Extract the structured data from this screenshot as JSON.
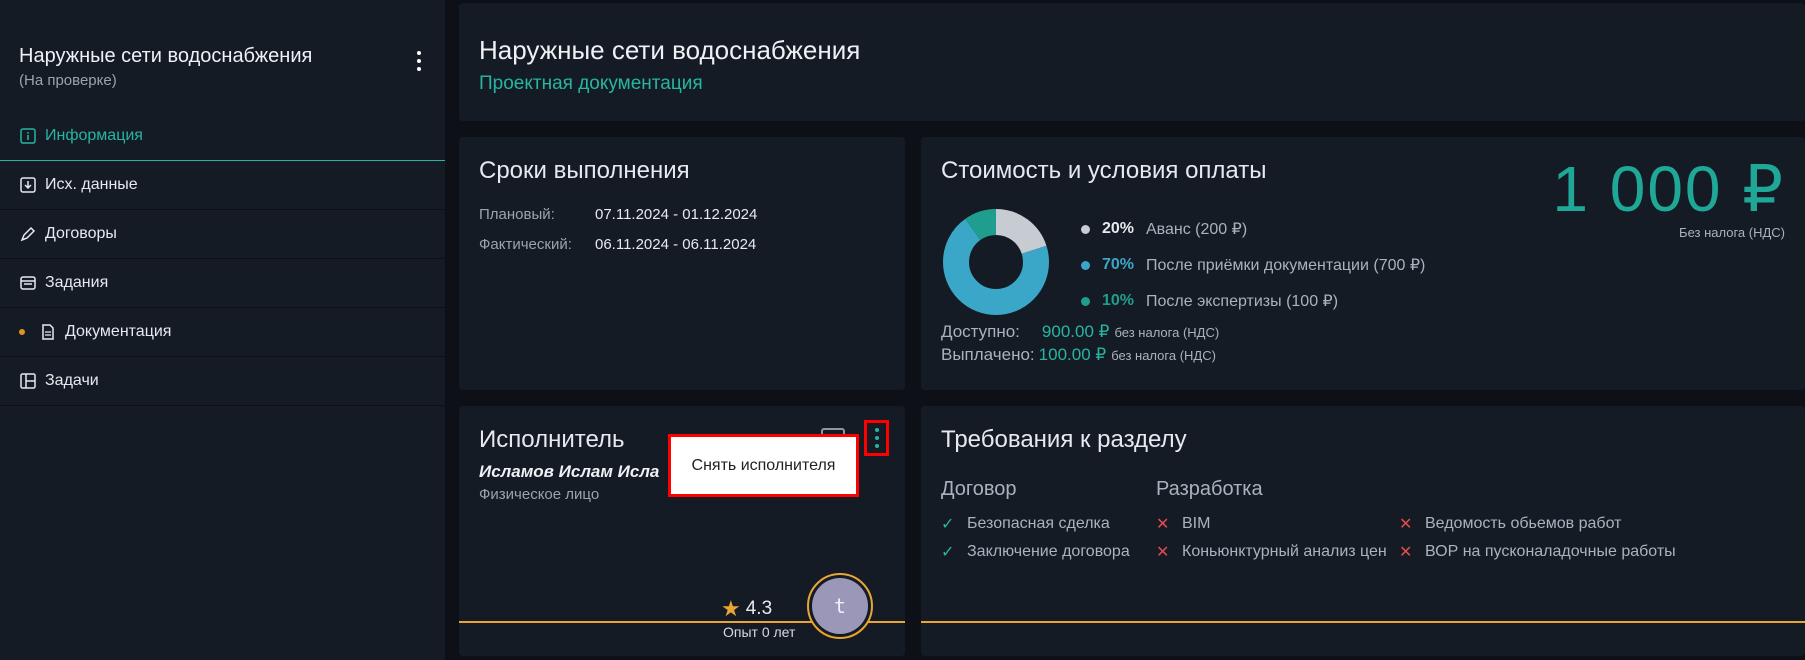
{
  "sidebar": {
    "title": "Наружные сети водоснабжения",
    "status": "(На проверке)",
    "items": [
      {
        "label": "Информация",
        "icon": "info-icon"
      },
      {
        "label": "Исх. данные",
        "icon": "download-icon"
      },
      {
        "label": "Договоры",
        "icon": "pen-icon"
      },
      {
        "label": "Задания",
        "icon": "window-icon"
      },
      {
        "label": "Документация",
        "icon": "document-icon"
      },
      {
        "label": "Задачи",
        "icon": "board-icon"
      }
    ]
  },
  "header": {
    "title": "Наружные сети водоснабжения",
    "subtitle": "Проектная документация"
  },
  "deadlines": {
    "title": "Сроки выполнения",
    "planned_label": "Плановый:",
    "planned_value": "07.11.2024 - 01.12.2024",
    "actual_label": "Фактический:",
    "actual_value": "06.11.2024 - 06.11.2024"
  },
  "cost": {
    "title": "Стоимость и условия оплаты",
    "price": "1 000 ₽",
    "price_note": "Без налога (НДС)",
    "items": [
      {
        "pct": "20%",
        "label": "Аванс (200 ₽)",
        "color": "#c7cbd2",
        "fraction": 0.2
      },
      {
        "pct": "70%",
        "label": "После приёмки документации (700 ₽)",
        "color": "#3aa7c9",
        "fraction": 0.7
      },
      {
        "pct": "10%",
        "label": "После экспертизы (100 ₽)",
        "color": "#1f9e8f",
        "fraction": 0.1
      }
    ],
    "available_label": "Доступно:",
    "available_value": "900.00 ₽",
    "available_note": "без налога (НДС)",
    "paid_label": "Выплачено:",
    "paid_value": "100.00 ₽",
    "paid_note": "без налога (НДС)"
  },
  "performer": {
    "title": "Исполнитель",
    "name": "Исламов Ислам Исла",
    "type": "Физическое лицо",
    "rating": "4.3",
    "experience": "Опыт 0 лет",
    "avatar_letter": "t",
    "menu_action": "Снять исполнителя"
  },
  "requirements": {
    "title": "Требования к разделу",
    "columns": [
      {
        "heading": "Договор",
        "items": [
          {
            "label": "Безопасная сделка",
            "ok": true
          },
          {
            "label": "Заключение договора",
            "ok": true
          }
        ]
      },
      {
        "heading": "Разработка",
        "items": [
          {
            "label": "BIM",
            "ok": false
          },
          {
            "label": "Коньюнктурный анализ цен",
            "ok": false
          }
        ]
      },
      {
        "heading": "",
        "items": [
          {
            "label": "Ведомость обьемов работ",
            "ok": false
          },
          {
            "label": "ВОР на пусконаладочные работы",
            "ok": false
          }
        ]
      }
    ]
  }
}
